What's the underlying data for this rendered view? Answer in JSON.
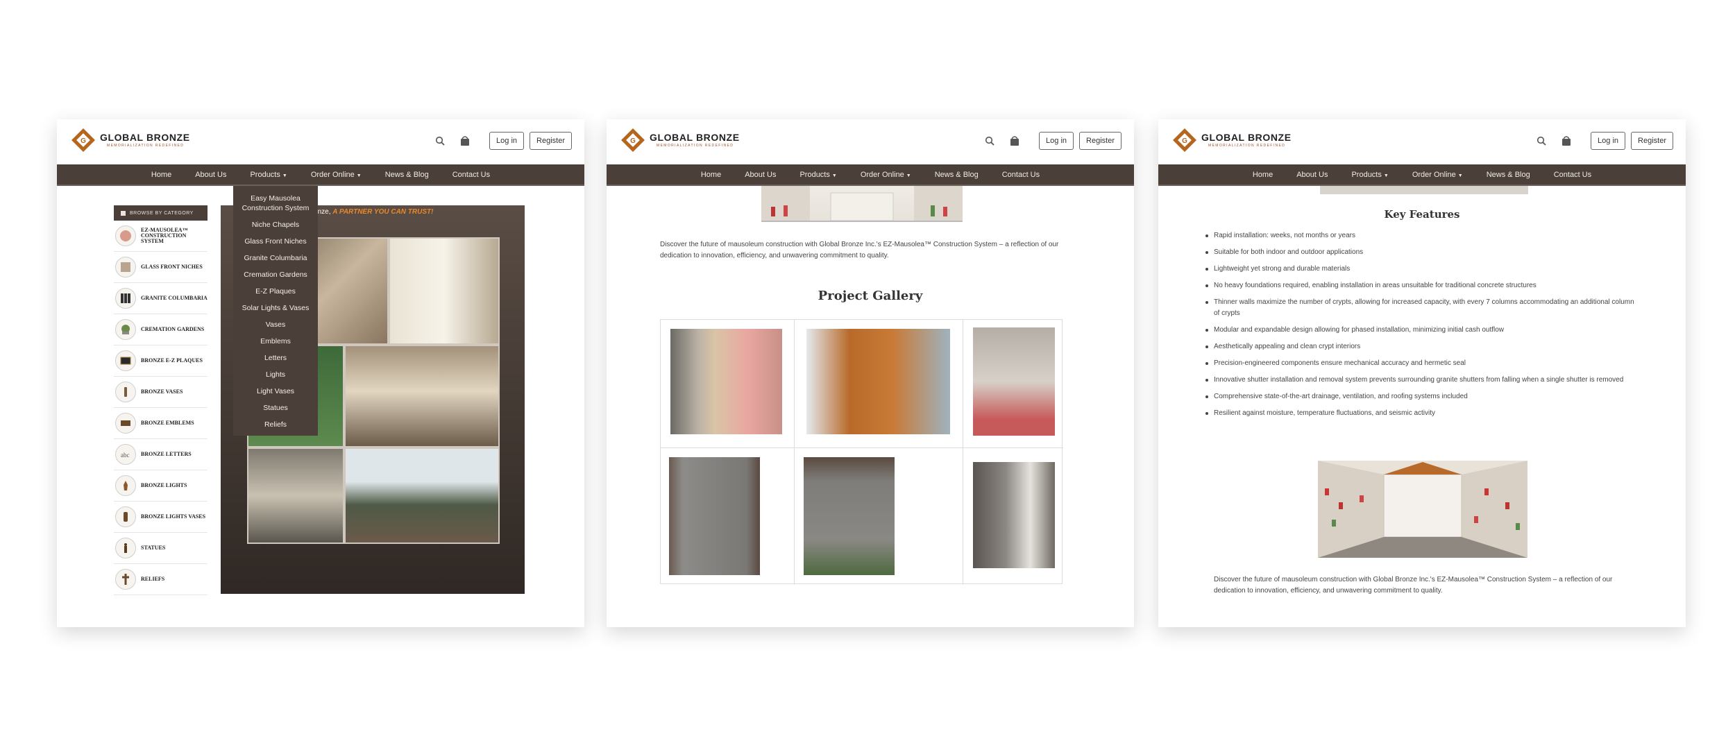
{
  "brand": {
    "name": "GLOBAL BRONZE",
    "tagline": "MEMORIALIZATION REDEFINED"
  },
  "header": {
    "login_label": "Log in",
    "register_label": "Register",
    "search_icon": "search-icon",
    "cart_icon": "cart-icon"
  },
  "nav": {
    "items": [
      "Home",
      "About Us",
      "Products",
      "Order Online",
      "News & Blog",
      "Contact Us"
    ]
  },
  "colors": {
    "nav_bg": "#4a3f39",
    "accent": "#e8892d",
    "logo_orange": "#b5651d"
  },
  "panel1": {
    "sidebar_title": "BROWSE BY CATEGORY",
    "sidebar_items": [
      "EZ-MAUSOLEA™ CONSTRUCTION SYSTEM",
      "GLASS FRONT NICHES",
      "GRANITE COLUMBARIA",
      "CREMATION GARDENS",
      "BRONZE E-Z PLAQUES",
      "BRONZE VASES",
      "BRONZE EMBLEMS",
      "BRONZE LETTERS",
      "BRONZE LIGHTS",
      "BRONZE LIGHTS VASES",
      "STATUES",
      "RELIEFS"
    ],
    "banner_prefix": "n Global Bronze,",
    "banner_highlight": "A PARTNER YOU CAN TRUST!",
    "dropdown": [
      "Easy Mausolea Construction System",
      "Niche Chapels",
      "Glass Front Niches",
      "Granite Columbaria",
      "Cremation Gardens",
      "E-Z Plaques",
      "Solar Lights & Vases",
      "Vases",
      "Emblems",
      "Letters",
      "Lights",
      "Light Vases",
      "Statues",
      "Reliefs"
    ]
  },
  "panel2": {
    "intro": "Discover the future of mausoleum construction with Global Bronze Inc.'s EZ-Mausolea™ Construction System – a reflection of our dedication to innovation, efficiency, and unwavering commitment to quality.",
    "gallery_title": "Project Gallery"
  },
  "panel3": {
    "features_title": "Key Features",
    "features": [
      "Rapid installation: weeks, not months or years",
      "Suitable for both indoor and outdoor applications",
      "Lightweight yet strong and durable materials",
      "No heavy foundations required, enabling installation in areas unsuitable for traditional concrete structures",
      "Thinner walls maximize the number of crypts, allowing for increased capacity, with every 7 columns accommodating an additional column of crypts",
      "Modular and expandable design allowing for phased installation, minimizing initial cash outflow",
      "Aesthetically appealing and clean crypt interiors",
      "Precision-engineered components ensure mechanical accuracy and hermetic seal",
      "Innovative shutter installation and removal system prevents surrounding granite shutters from falling when a single shutter is removed",
      "Comprehensive state-of-the-art drainage, ventilation, and roofing systems included",
      "Resilient against moisture, temperature fluctuations, and seismic activity"
    ],
    "outro": "Discover the future of mausoleum construction with Global Bronze Inc.'s EZ-Mausolea™ Construction System – a reflection of our dedication to innovation, efficiency, and unwavering commitment to quality."
  }
}
